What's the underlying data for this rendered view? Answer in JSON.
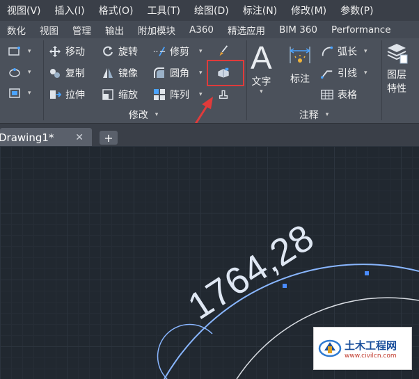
{
  "menubar": {
    "items": [
      {
        "label": "视图(V)"
      },
      {
        "label": "插入(I)"
      },
      {
        "label": "格式(O)"
      },
      {
        "label": "工具(T)"
      },
      {
        "label": "绘图(D)"
      },
      {
        "label": "标注(N)"
      },
      {
        "label": "修改(M)"
      },
      {
        "label": "参数(P)"
      }
    ]
  },
  "ribbon_tabs": {
    "items": [
      {
        "label": "数化"
      },
      {
        "label": "视图"
      },
      {
        "label": "管理"
      },
      {
        "label": "输出"
      },
      {
        "label": "附加模块"
      },
      {
        "label": "A360"
      },
      {
        "label": "精选应用"
      },
      {
        "label": "BIM 360"
      },
      {
        "label": "Performance"
      }
    ]
  },
  "modify_panel": {
    "move": "移动",
    "rotate": "旋转",
    "trim": "修剪",
    "copy": "复制",
    "mirror": "镜像",
    "fillet": "圆角",
    "stretch": "拉伸",
    "scale": "缩放",
    "array": "阵列",
    "footer": "修改"
  },
  "annotation_panel": {
    "text": "文字",
    "dimension": "标注",
    "arc_length": "弧长",
    "leader": "引线",
    "table": "表格",
    "footer": "注释"
  },
  "layer_panel": {
    "label_line1": "图层",
    "label_line2": "特性"
  },
  "document_tabs": {
    "active": "Drawing1*"
  },
  "canvas": {
    "dimension_text": "1764,28"
  },
  "watermark": {
    "title": "土木工程网",
    "url": "www.civilcn.com"
  },
  "colors": {
    "highlight": "#e03b3b",
    "arrow": "#e03b3b",
    "canvas_bg": "#212830",
    "arc": "#7fb0ff"
  }
}
